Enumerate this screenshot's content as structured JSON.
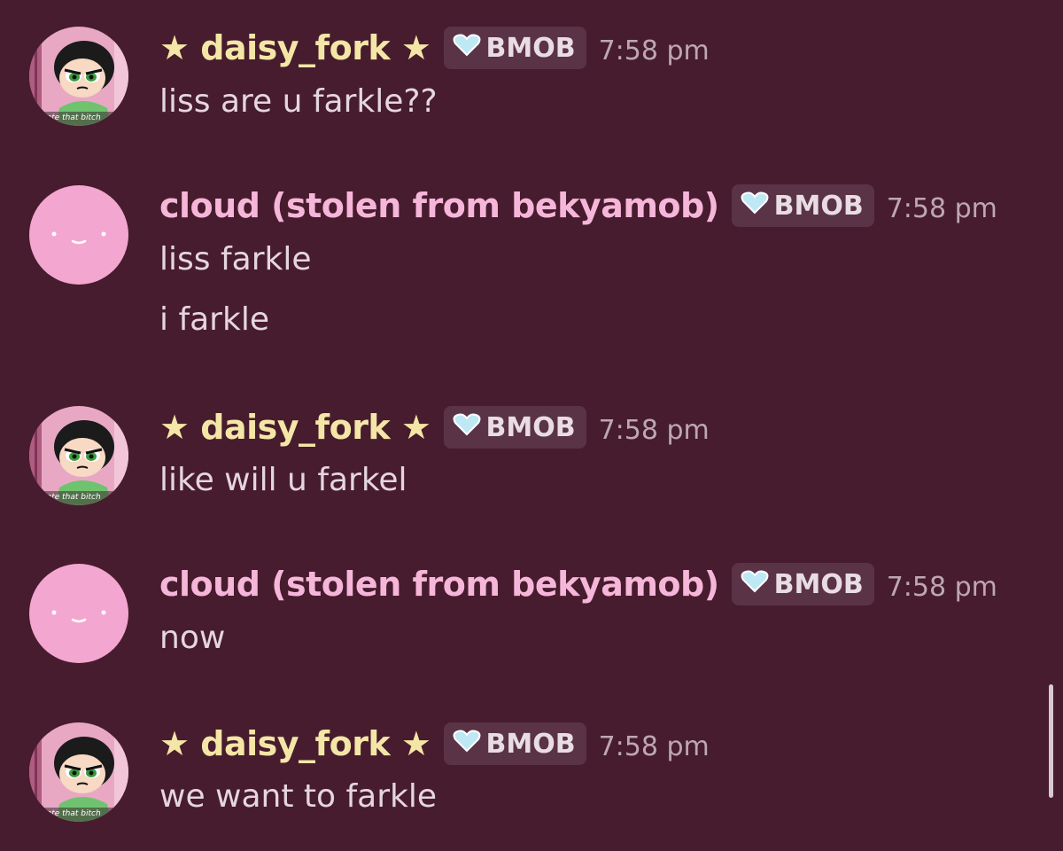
{
  "theme": {
    "background": "#471c2e",
    "daisy_name_color": "#f4e6a6",
    "cloud_name_color": "#f6b6d9",
    "badge_background": "#5b3346",
    "text_color": "#e5d6dd",
    "timestamp_color": "#bda7b2",
    "heart_color": "#bfe8f5"
  },
  "messages": [
    {
      "username": "★ daisy_fork ★",
      "badge": "BMOB",
      "badge_icon": "heart-icon",
      "time": "7:58 pm",
      "avatar_icon": "buttercup-avatar-icon",
      "avatar_caption": "hate that bitch",
      "lines": [
        "liss are u farkle??"
      ]
    },
    {
      "username": "cloud (stolen from bekyamob)",
      "badge": "BMOB",
      "badge_icon": "heart-icon",
      "time": "7:58 pm",
      "avatar_icon": "cloud-face-avatar-icon",
      "lines": [
        "liss farkle",
        "i farkle"
      ]
    },
    {
      "username": "★ daisy_fork ★",
      "badge": "BMOB",
      "badge_icon": "heart-icon",
      "time": "7:58 pm",
      "avatar_icon": "buttercup-avatar-icon",
      "avatar_caption": "hate that bitch",
      "lines": [
        "like will u farkel"
      ]
    },
    {
      "username": "cloud (stolen from bekyamob)",
      "badge": "BMOB",
      "badge_icon": "heart-icon",
      "time": "7:58 pm",
      "avatar_icon": "cloud-face-avatar-icon",
      "lines": [
        "now"
      ]
    },
    {
      "username": "★ daisy_fork ★",
      "badge": "BMOB",
      "badge_icon": "heart-icon",
      "time": "7:58 pm",
      "avatar_icon": "buttercup-avatar-icon",
      "avatar_caption": "hate that bitch",
      "lines": [
        "we want to farkle"
      ]
    }
  ]
}
